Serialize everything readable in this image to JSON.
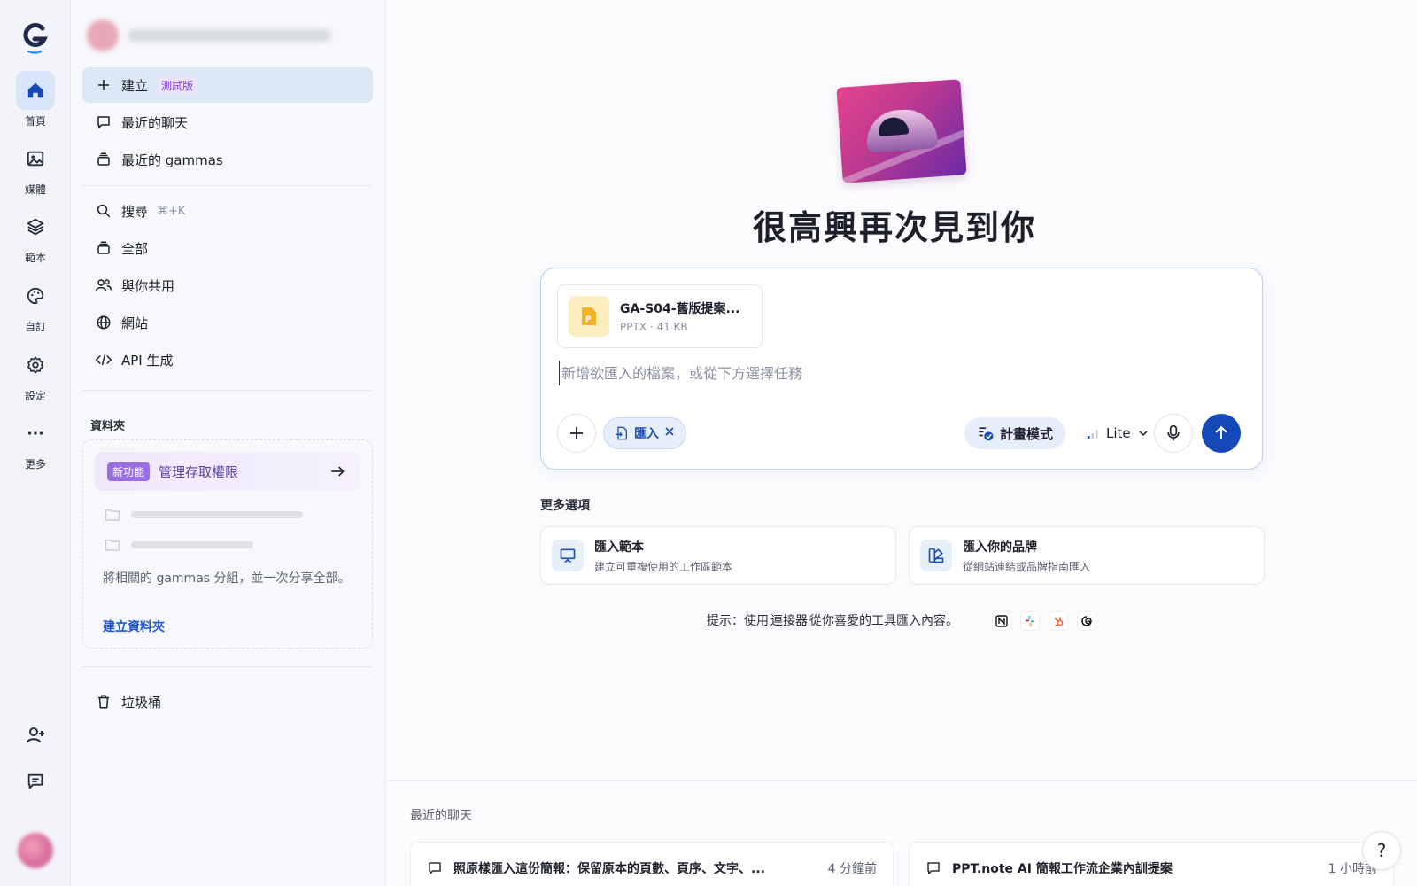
{
  "rail": {
    "logo": "G",
    "items": [
      {
        "label": "首頁",
        "icon": "home-icon"
      },
      {
        "label": "媒體",
        "icon": "image-icon"
      },
      {
        "label": "範本",
        "icon": "layers-icon"
      },
      {
        "label": "自訂",
        "icon": "palette-icon"
      },
      {
        "label": "設定",
        "icon": "gear-icon"
      },
      {
        "label": "更多",
        "icon": "more-icon"
      }
    ]
  },
  "sidebar": {
    "create": {
      "label": "建立",
      "badge": "測試版"
    },
    "recent_chats": "最近的聊天",
    "recent_gammas": "最近的 gammas",
    "search": {
      "label": "搜尋",
      "shortcut": "⌘+K"
    },
    "all": "全部",
    "shared": "與你共用",
    "sites": "網站",
    "api": "API 生成",
    "folders_title": "資料夾",
    "folder_card": {
      "new_badge": "新功能",
      "title": "管理存取權限",
      "description": "將相關的 gammas 分組，並一次分享全部。",
      "link": "建立資料夾"
    },
    "trash": "垃圾桶"
  },
  "main": {
    "greeting": "很高興再次見到你",
    "file": {
      "name": "GA-S04-舊版提案...",
      "meta": "PPTX · 41 KB"
    },
    "prompt_placeholder": "新增欲匯入的檔案，或從下方選擇任務",
    "import_chip": "匯入",
    "plan_mode": "計畫模式",
    "model": "Lite",
    "more_options_title": "更多選項",
    "options": [
      {
        "title": "匯入範本",
        "subtitle": "建立可重複使用的工作區範本"
      },
      {
        "title": "匯入你的品牌",
        "subtitle": "從網站連結或品牌指南匯入"
      }
    ],
    "tip": {
      "prefix": "提示：使用",
      "link": "連接器",
      "suffix": "從你喜愛的工具匯入內容。"
    },
    "recent_title": "最近的聊天",
    "recent": [
      {
        "title": "照原樣匯入這份簡報：保留原本的頁數、頁序、文字、...",
        "time": "4 分鐘前"
      },
      {
        "title": "PPT.note AI 簡報工作流企業內訓提案",
        "time": "1 小時前"
      }
    ],
    "help": "?"
  },
  "colors": {
    "accent": "#1649b8",
    "active_bg": "#dbe6f7",
    "beta": "#7b3fd6"
  }
}
